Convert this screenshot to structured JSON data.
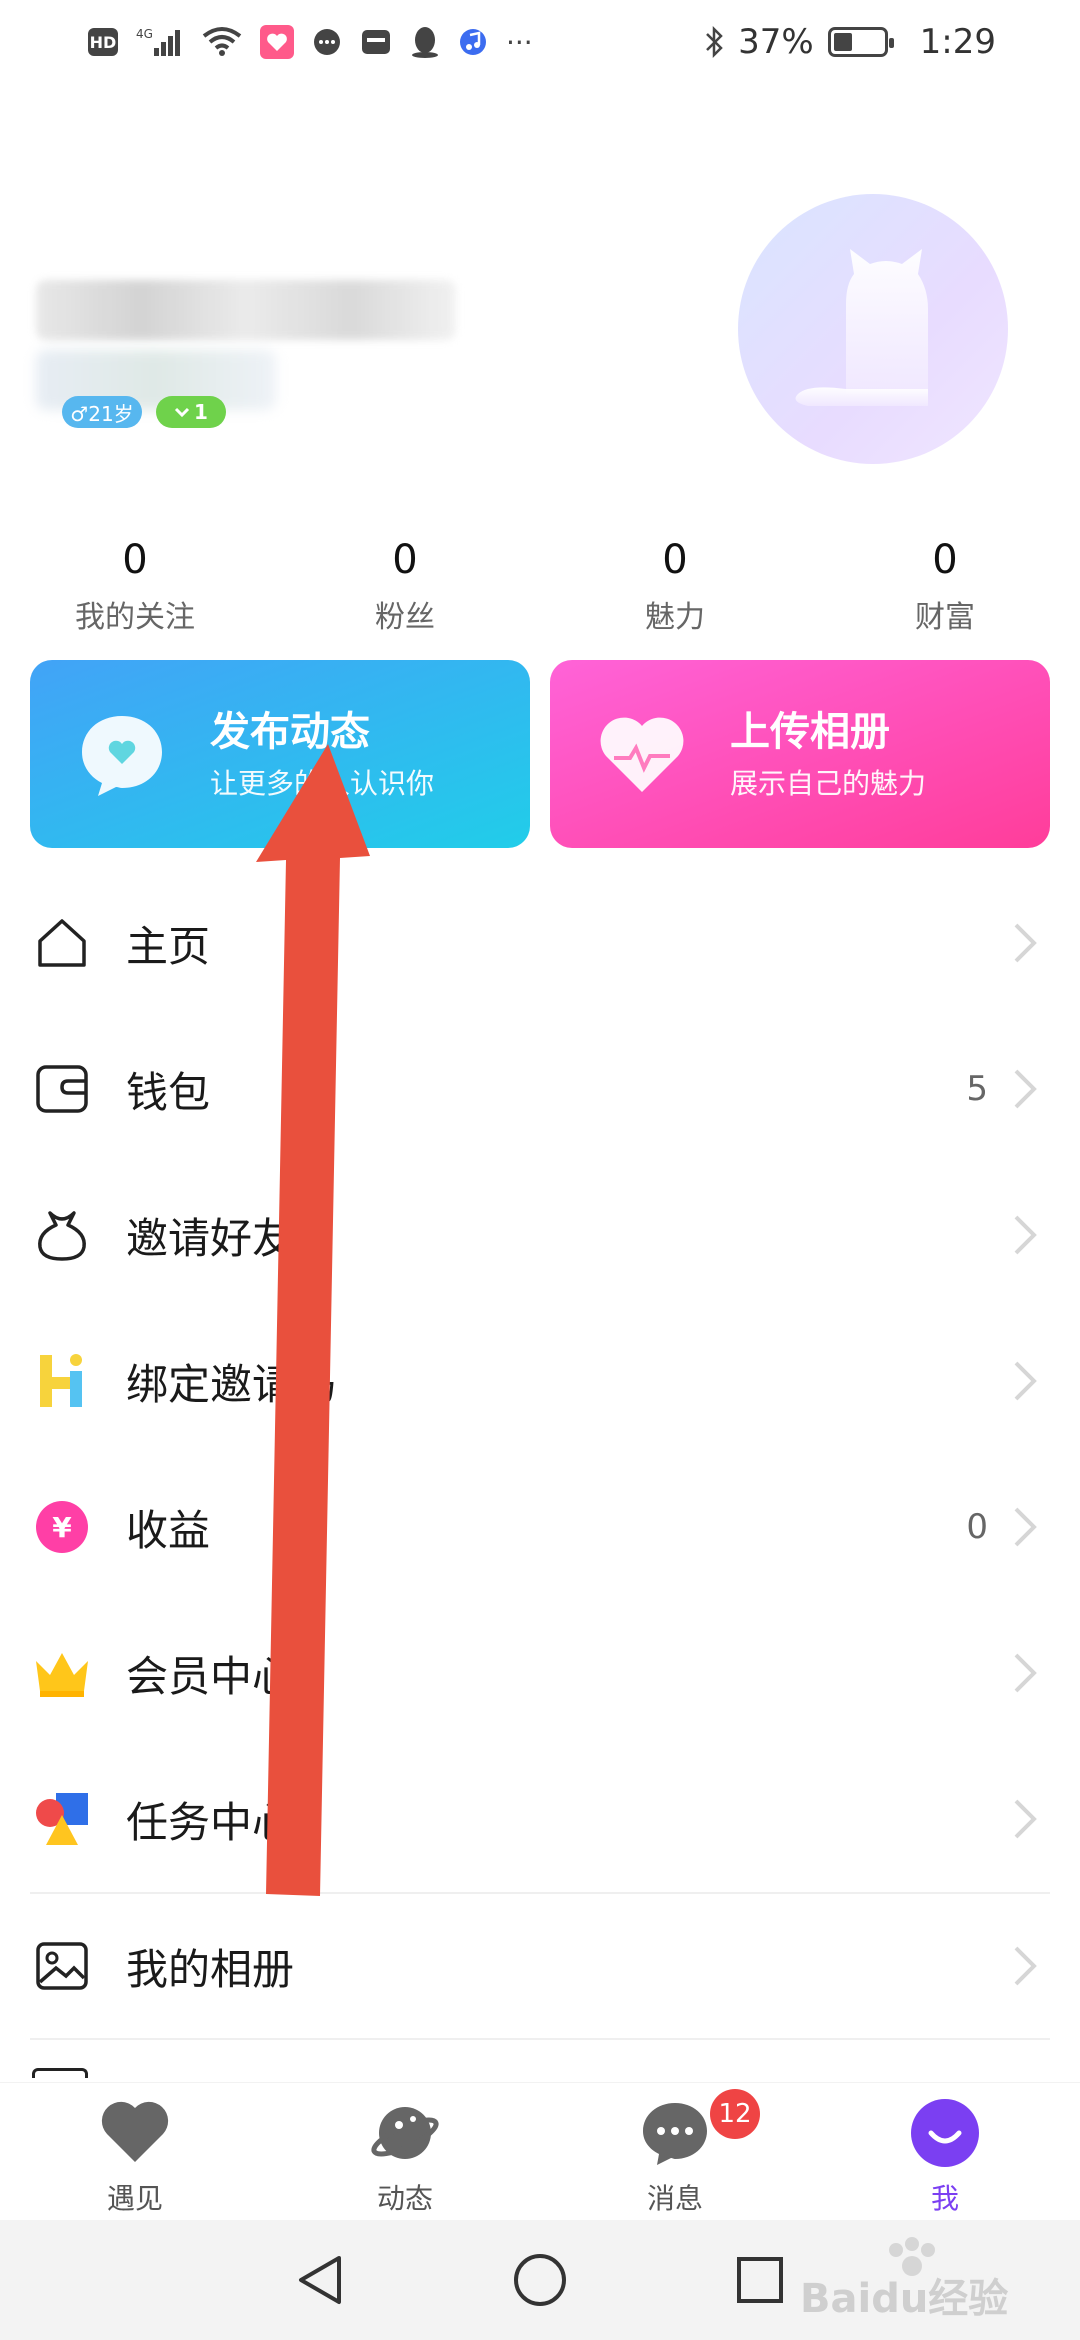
{
  "status_bar": {
    "hd": "HD",
    "network": "4G",
    "battery_percent": "37%",
    "battery_level": 0.37,
    "time": "1:29",
    "more": "···"
  },
  "profile": {
    "age_tag": "♂21岁",
    "level_tag": "1"
  },
  "stats": [
    {
      "value": "0",
      "label": "我的关注"
    },
    {
      "value": "0",
      "label": "粉丝"
    },
    {
      "value": "0",
      "label": "魅力"
    },
    {
      "value": "0",
      "label": "财富"
    }
  ],
  "cards": {
    "post": {
      "title": "发布动态",
      "subtitle": "让更多的人认识你"
    },
    "album": {
      "title": "上传相册",
      "subtitle": "展示自己的魅力"
    }
  },
  "menu": [
    {
      "label": "主页",
      "value": "",
      "icon": "home-icon"
    },
    {
      "label": "钱包",
      "value": "5",
      "icon": "wallet-icon"
    },
    {
      "label": "邀请好友",
      "value": "",
      "icon": "gift-bag-icon"
    },
    {
      "label": "绑定邀请码",
      "value": "",
      "icon": "invite-code-icon"
    },
    {
      "label": "收益",
      "value": "0",
      "icon": "yuan-coin-icon"
    },
    {
      "label": "会员中心",
      "value": "",
      "icon": "crown-icon"
    },
    {
      "label": "任务中心",
      "value": "",
      "icon": "shapes-icon"
    },
    {
      "label": "我的相册",
      "value": "",
      "icon": "photo-icon"
    }
  ],
  "tabs": [
    {
      "label": "遇见",
      "icon": "heart-icon"
    },
    {
      "label": "动态",
      "icon": "planet-icon"
    },
    {
      "label": "消息",
      "icon": "chat-bubble-icon",
      "badge": "12"
    },
    {
      "label": "我",
      "icon": "smile-icon",
      "active": true
    }
  ],
  "colors": {
    "accent_purple": "#7b3ff2",
    "card_blue": "#3aa6f5",
    "card_pink": "#ff4fb7",
    "arrow_red": "#e9503d",
    "badge_red": "#ef4444"
  },
  "watermark": "Baidu经验"
}
